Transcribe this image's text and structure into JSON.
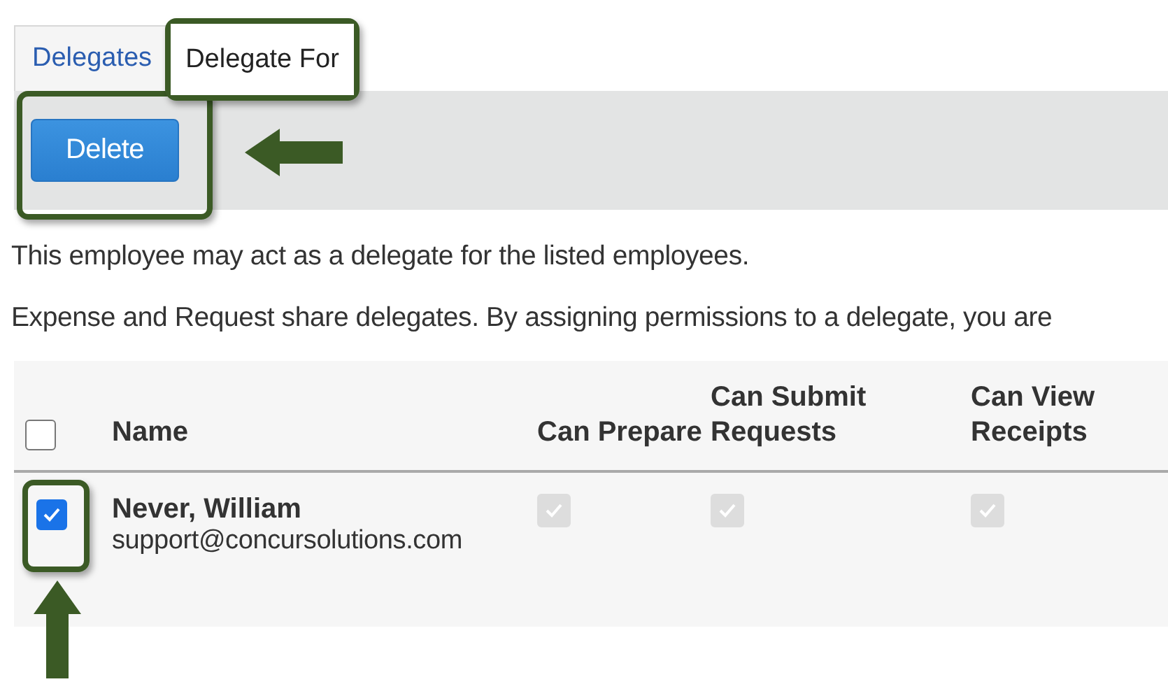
{
  "tabs": [
    {
      "label": "Delegates",
      "selected": false,
      "highlighted": false
    },
    {
      "label": "Delegate For",
      "selected": true,
      "highlighted": true
    }
  ],
  "toolbar": {
    "button": {
      "label": "Delete",
      "highlighted": true,
      "pointer_arrow": true
    }
  },
  "messages": [
    "This employee may act as a delegate for the listed employees.",
    "Expense and Request share delegates. By assigning permissions to a delegate, you are"
  ],
  "table": {
    "select_all": {
      "checked": false
    },
    "columns": [
      "Name",
      "Can Prepare",
      "Can Submit Requests",
      "Can View Receipts"
    ],
    "rows": [
      {
        "selected": true,
        "highlighted": true,
        "pointer_arrow": true,
        "name": "Never, William",
        "email": "support@concursolutions.com",
        "permissions": [
          {
            "checked": true,
            "disabled": true
          },
          {
            "checked": true,
            "disabled": true
          },
          {
            "checked": true,
            "disabled": true
          }
        ]
      }
    ]
  }
}
